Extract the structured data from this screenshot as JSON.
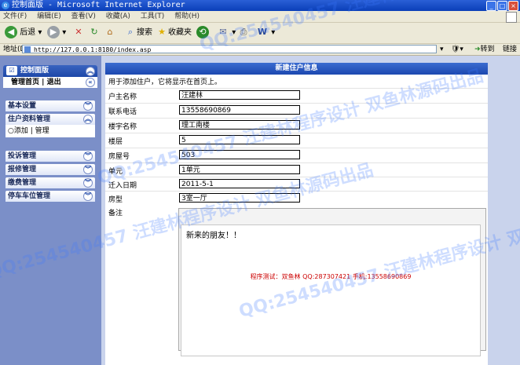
{
  "window": {
    "title": "控制面版 - Microsoft Internet Explorer"
  },
  "menu": [
    "文件(F)",
    "编辑(E)",
    "查看(V)",
    "收藏(A)",
    "工具(T)",
    "帮助(H)"
  ],
  "toolbar": {
    "back": "后退",
    "search": "搜索",
    "favorites": "收藏夹"
  },
  "address": {
    "label": "地址(D)",
    "url": "http://127.0.0.1:8180/index.asp",
    "go": "转到",
    "links": "链接"
  },
  "sidebar": {
    "title": "控制面版",
    "links": [
      "管理首页",
      "退出"
    ],
    "sections": [
      {
        "label": "基本设置"
      },
      {
        "label": "住户资料管理",
        "sub": [
          "添加",
          "管理"
        ]
      },
      {
        "label": "投诉管理"
      },
      {
        "label": "报修管理"
      },
      {
        "label": "缴费管理"
      },
      {
        "label": "停车车位管理"
      }
    ]
  },
  "form": {
    "header": "新建住户信息",
    "hint": "用于添加住户，它将显示在首页上。",
    "fields": [
      {
        "label": "户主名称",
        "value": "汪建林"
      },
      {
        "label": "联系电话",
        "value": "13558690869"
      },
      {
        "label": "楼宇名称",
        "value": "理工南楼"
      },
      {
        "label": "楼层",
        "value": "5"
      },
      {
        "label": "房屋号",
        "value": "503"
      },
      {
        "label": "单元",
        "value": "1单元"
      },
      {
        "label": "迁入日期",
        "value": "2011-5-1"
      },
      {
        "label": "房型",
        "value": "3室一厅"
      }
    ],
    "remark_label": "备注",
    "remark_text": "新来的朋友！！",
    "credit": "程序测试：双鱼林 QQ:287307421 手机:13558690869"
  },
  "watermark": "QQ:254540457 汪建林程序设计 双鱼林源码出品",
  "colors": {
    "sidebar": "#7b8fc8",
    "header": "#1c48b0",
    "credit": "#cc0000"
  }
}
